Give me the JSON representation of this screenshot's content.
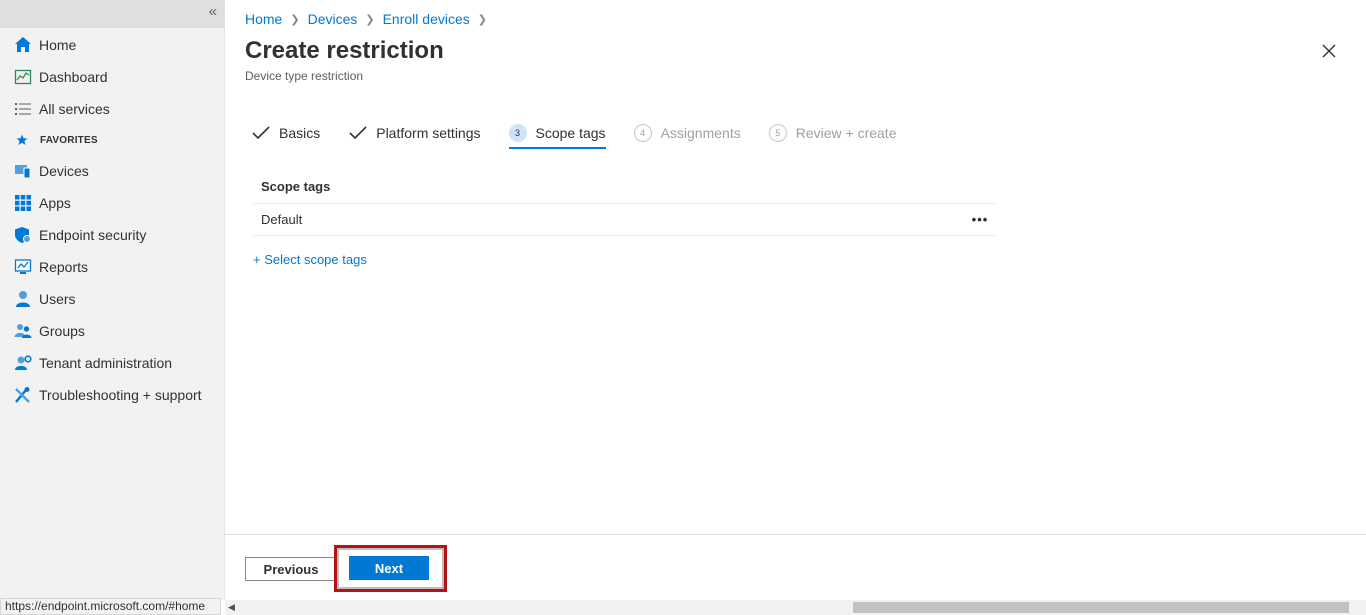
{
  "sidebar": {
    "collapse_icon": "«",
    "items": [
      {
        "label": "Home",
        "icon": "home-icon"
      },
      {
        "label": "Dashboard",
        "icon": "dashboard-icon"
      },
      {
        "label": "All services",
        "icon": "list-icon"
      }
    ],
    "favorites_label": "FAVORITES",
    "favorites": [
      {
        "label": "Devices",
        "icon": "devices-icon"
      },
      {
        "label": "Apps",
        "icon": "apps-icon"
      },
      {
        "label": "Endpoint security",
        "icon": "shield-icon"
      },
      {
        "label": "Reports",
        "icon": "reports-icon"
      },
      {
        "label": "Users",
        "icon": "user-icon"
      },
      {
        "label": "Groups",
        "icon": "groups-icon"
      },
      {
        "label": "Tenant administration",
        "icon": "tenant-admin-icon"
      },
      {
        "label": "Troubleshooting + support",
        "icon": "tools-icon"
      }
    ]
  },
  "breadcrumb": [
    "Home",
    "Devices",
    "Enroll devices"
  ],
  "header": {
    "title": "Create restriction",
    "subtitle": "Device type restriction"
  },
  "steps": [
    {
      "label": "Basics",
      "state": "done"
    },
    {
      "label": "Platform settings",
      "state": "done"
    },
    {
      "number": "3",
      "label": "Scope tags",
      "state": "active"
    },
    {
      "number": "4",
      "label": "Assignments",
      "state": "pending"
    },
    {
      "number": "5",
      "label": "Review + create",
      "state": "pending"
    }
  ],
  "scope_table": {
    "header": "Scope tags",
    "rows": [
      {
        "name": "Default",
        "more": "•••"
      }
    ]
  },
  "select_scope_tags_link": "+ Select scope tags",
  "footer": {
    "previous_label": "Previous",
    "next_label": "Next"
  },
  "status_url": "https://endpoint.microsoft.com/#home",
  "colors": {
    "accent": "#0078d4",
    "highlight": "#b31316",
    "sidebar_bg": "#f2f2f2"
  }
}
